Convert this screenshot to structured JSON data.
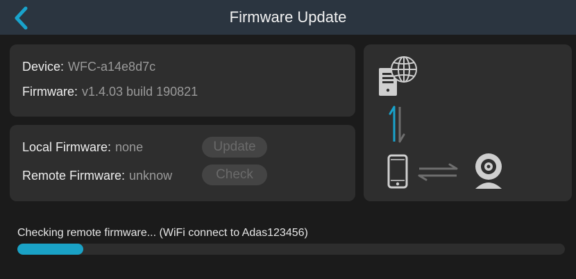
{
  "header": {
    "title": "Firmware Update",
    "back_icon": "chevron-left-icon"
  },
  "device_info": {
    "device_label": "Device:",
    "device_value": "WFC-a14e8d7c",
    "firmware_label": "Firmware:",
    "firmware_value": "v1.4.03 build 190821"
  },
  "firmware": {
    "local_label": "Local Firmware:",
    "local_value": "none",
    "update_button": "Update",
    "remote_label": "Remote Firmware:",
    "remote_value": "unknow",
    "check_button": "Check"
  },
  "diagram": {
    "icons": [
      "server-globe-icon",
      "up-down-arrows-icon",
      "phone-icon",
      "left-right-arrows-icon",
      "camera-icon"
    ]
  },
  "status": {
    "text": "Checking remote firmware... (WiFi connect to Adas123456)",
    "progress_fraction": 0.12
  },
  "colors": {
    "accent": "#1aa2c6",
    "header_bg": "#2b3540",
    "card_bg": "#2e2e2e"
  }
}
